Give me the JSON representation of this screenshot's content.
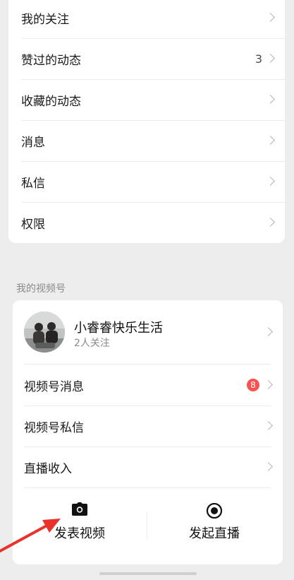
{
  "settings": {
    "items": [
      {
        "label": "我的关注",
        "count": ""
      },
      {
        "label": "赞过的动态",
        "count": "3"
      },
      {
        "label": "收藏的动态",
        "count": ""
      },
      {
        "label": "消息",
        "count": ""
      },
      {
        "label": "私信",
        "count": ""
      },
      {
        "label": "权限",
        "count": ""
      }
    ]
  },
  "channels": {
    "section_title": "我的视频号",
    "profile": {
      "name": "小睿睿快乐生活",
      "followers": "2人关注"
    },
    "items": [
      {
        "label": "视频号消息",
        "badge": "8"
      },
      {
        "label": "视频号私信",
        "badge": ""
      },
      {
        "label": "直播收入",
        "badge": ""
      }
    ],
    "actions": {
      "post_video": {
        "label": "发表视频",
        "icon": "camera-icon"
      },
      "start_live": {
        "label": "发起直播",
        "icon": "live-record-icon"
      }
    }
  },
  "colors": {
    "badge": "#fa5151",
    "annotation_arrow": "#e8322b"
  }
}
